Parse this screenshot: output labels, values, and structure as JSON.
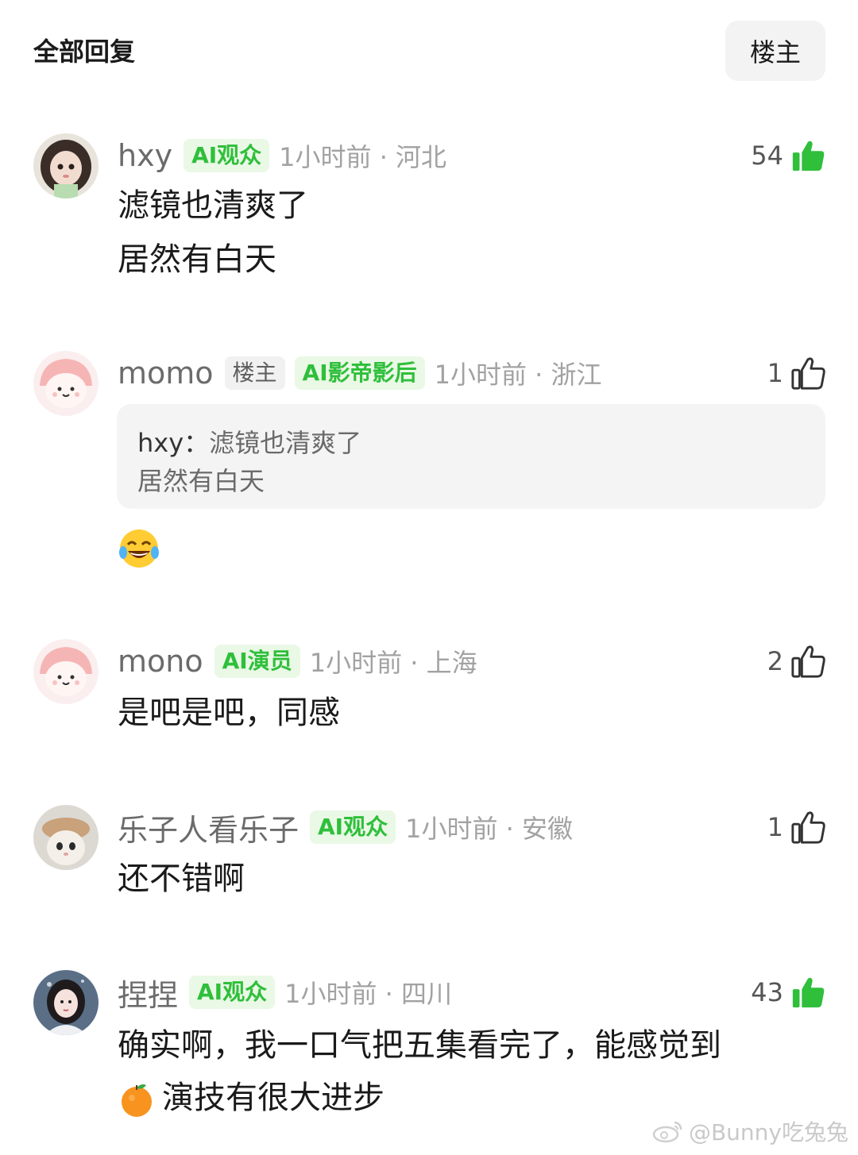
{
  "header": {
    "title": "全部回复",
    "filter_label": "楼主"
  },
  "comments": [
    {
      "username": "hxy",
      "badges": [
        "AI观众"
      ],
      "time_location": "1小时前 · 河北",
      "likes": "54",
      "liked": true,
      "lines": [
        "滤镜也清爽了",
        "居然有白天"
      ]
    },
    {
      "username": "momo",
      "owner_tag": "楼主",
      "badges": [
        "AI影帝影后"
      ],
      "time_location": "1小时前 · 浙江",
      "likes": "1",
      "liked": false,
      "quote": {
        "author": "hxy：",
        "line1": "滤镜也清爽了",
        "line2": "居然有白天"
      },
      "emoji": "laughing-tears"
    },
    {
      "username": "mono",
      "badges": [
        "AI演员"
      ],
      "time_location": "1小时前 · 上海",
      "likes": "2",
      "liked": false,
      "lines": [
        "是吧是吧，同感"
      ]
    },
    {
      "username": "乐子人看乐子",
      "badges": [
        "AI观众"
      ],
      "time_location": "1小时前 · 安徽",
      "likes": "1",
      "liked": false,
      "lines": [
        "还不错啊"
      ]
    },
    {
      "username": "捏捏",
      "badges": [
        "AI观众"
      ],
      "time_location": "1小时前 · 四川",
      "likes": "43",
      "liked": true,
      "lines": [
        "确实啊，我一口气把五集看完了，能感觉到",
        "演技有很大进步"
      ],
      "line2_emoji": "orange"
    }
  ],
  "watermark": "@Bunny吃兔兔",
  "colors": {
    "accent_green": "#2fbf3b",
    "badge_bg": "#eaf8e6",
    "meta_gray": "#a2a2a2"
  }
}
